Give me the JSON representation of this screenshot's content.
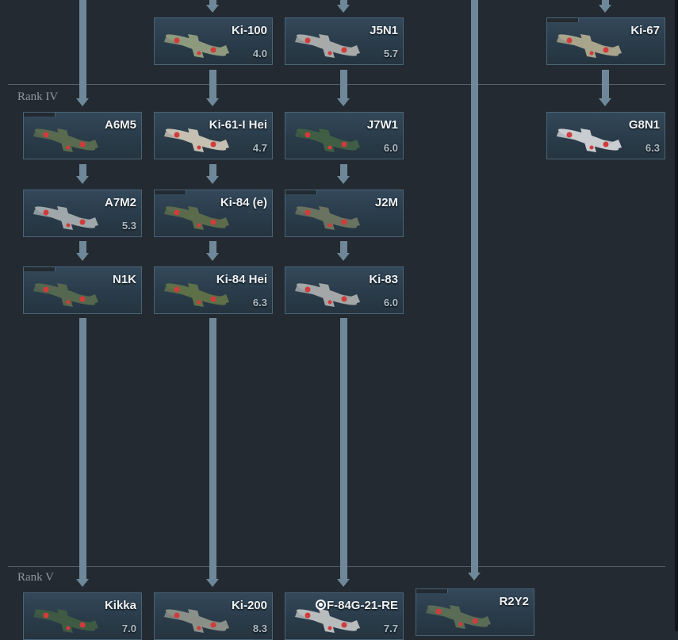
{
  "ranks": [
    {
      "label": "Rank IV"
    },
    {
      "label": "Rank V"
    }
  ],
  "vehicles": [
    {
      "name": "Ki-100",
      "br": "4.0",
      "color": "#8e9a7e"
    },
    {
      "name": "J5N1",
      "br": "5.7",
      "color": "#a7aaa8"
    },
    {
      "name": "Ki-67",
      "br": "",
      "color": "#a9a48c"
    },
    {
      "name": "A6M5",
      "br": "",
      "color": "#596a4f"
    },
    {
      "name": "Ki-61-I Hei",
      "br": "4.7",
      "color": "#c5c0b2"
    },
    {
      "name": "J7W1",
      "br": "6.0",
      "color": "#3f5e44"
    },
    {
      "name": "G8N1",
      "br": "6.3",
      "color": "#c9ccd0"
    },
    {
      "name": "A7M2",
      "br": "5.3",
      "color": "#a0a7aa"
    },
    {
      "name": "Ki-84 (e)",
      "br": "",
      "color": "#5b6b4c"
    },
    {
      "name": "J2M",
      "br": "",
      "color": "#6a7260"
    },
    {
      "name": "N1K",
      "br": "",
      "color": "#55674f"
    },
    {
      "name": "Ki-84 Hei",
      "br": "6.3",
      "color": "#5e7048"
    },
    {
      "name": "Ki-83",
      "br": "6.0",
      "color": "#a3a7a8"
    },
    {
      "name": "Kikka",
      "br": "7.0",
      "color": "#3f5a43"
    },
    {
      "name": "Ki-200",
      "br": "8.3",
      "color": "#8a8f88"
    },
    {
      "name": "F-84G-21-RE",
      "br": "7.7",
      "color": "#b9bcbc",
      "icon": "target-icon"
    },
    {
      "name": "R2Y2",
      "br": "",
      "color": "#5a6c55"
    }
  ],
  "accent": {
    "line": "#6f8899",
    "hinomaru": "#d23b3b"
  }
}
